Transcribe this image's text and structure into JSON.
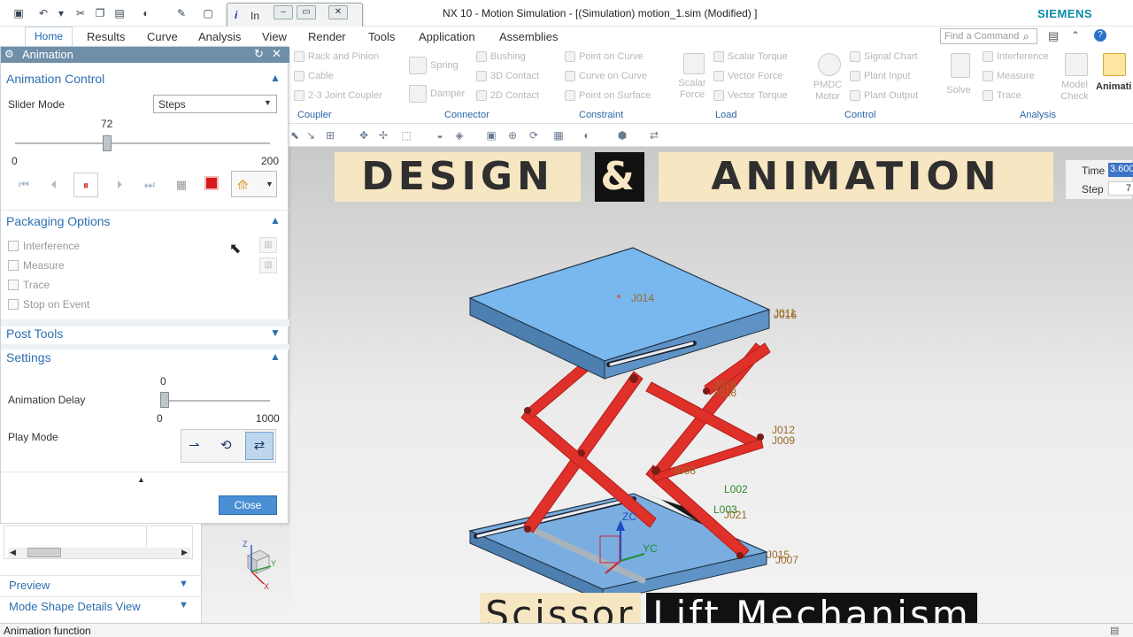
{
  "window": {
    "title": "NX 10 - Motion Simulation - [(Simulation) motion_1.sim (Modified) ]",
    "brand": "SIEMENS"
  },
  "info_window": {
    "label": "i",
    "text": "In"
  },
  "menu": {
    "items": [
      "Home",
      "Results",
      "Curve",
      "Analysis",
      "View",
      "Render",
      "Tools",
      "Application",
      "Assemblies"
    ],
    "find_placeholder": "Find a Command"
  },
  "ribbon": {
    "coupler": {
      "items": [
        "Rack and Pinion",
        "Cable",
        "2-3 Joint Coupler"
      ],
      "label": "Coupler"
    },
    "connector": {
      "items": [
        "Spring",
        "Damper",
        "Bushing",
        "3D Contact",
        "2D Contact"
      ],
      "label": "Connector"
    },
    "constraint": {
      "items": [
        "Point on Curve",
        "Curve on Curve",
        "Point on Surface"
      ],
      "label": "Constraint"
    },
    "load": {
      "scalar_force": "Scalar Force",
      "items": [
        "Scalar Torque",
        "Vector Force",
        "Vector Torque"
      ],
      "label": "Load"
    },
    "control": {
      "pmdc_motor": "PMDC Motor",
      "items": [
        "Signal Chart",
        "Plant Input",
        "Plant Output"
      ],
      "label": "Control"
    },
    "analysis": {
      "solve": "Solve",
      "items": [
        "Interference",
        "Measure",
        "Trace"
      ],
      "model_check": "Model Check",
      "animation": "Animati",
      "label": "Analysis"
    }
  },
  "panel": {
    "title": "Animation",
    "animation_control": {
      "title": "Animation Control",
      "slider_mode_label": "Slider Mode",
      "slider_mode_value": "Steps",
      "slider_value": "72",
      "slider_fraction": 0.36,
      "slider_min": "0",
      "slider_max": "200"
    },
    "packaging": {
      "title": "Packaging Options",
      "options": [
        "Interference",
        "Measure",
        "Trace",
        "Stop on Event"
      ]
    },
    "post_tools": "Post Tools",
    "settings": {
      "title": "Settings",
      "delay_label": "Animation Delay",
      "delay_value": "0",
      "delay_min": "0",
      "delay_max": "1000",
      "play_mode_label": "Play Mode"
    },
    "close_label": "Close"
  },
  "lower_panel": {
    "preview": "Preview",
    "mode_shape": "Mode Shape Details View"
  },
  "time_box": {
    "time_label": "Time",
    "time_value": "3.600",
    "step_label": "Step",
    "step_value": "7"
  },
  "overlay": {
    "design": "DESIGN",
    "amp": "&",
    "animation": "ANIMATION",
    "scissor": "Scissor",
    "lift": "Lift Mechanism"
  },
  "joints": {
    "j014": "J014",
    "j011": "J011",
    "j016": "J016",
    "j019": "J019",
    "j018": "J018",
    "j012": "J012",
    "j009": "J009",
    "j008": "J008",
    "l002": "L002",
    "l003": "L003",
    "j021": "J021",
    "j015": "J015",
    "j007": "J007",
    "zc": "ZC",
    "yc": "YC"
  },
  "status": {
    "text": "Animation function"
  },
  "colors": {
    "accent": "#2d6fb0",
    "header": "#6f8fa9",
    "scissor_red": "#e0302a",
    "plate_blue": "#79b8ee"
  }
}
